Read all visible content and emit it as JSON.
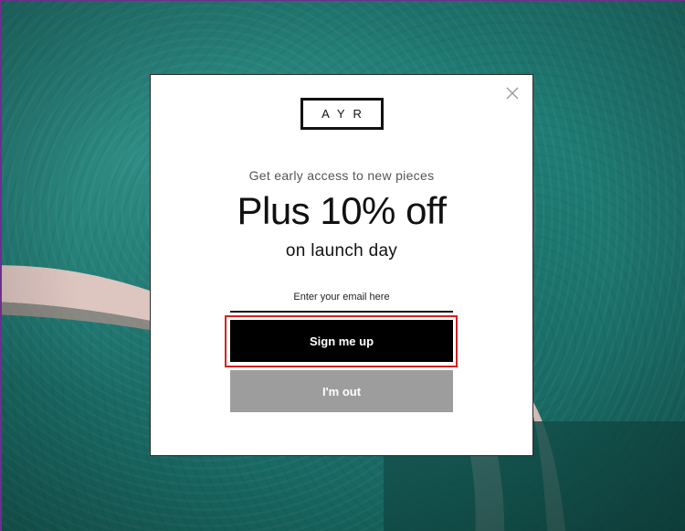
{
  "popup": {
    "logo_text": "AYR",
    "subhead": "Get early access to new pieces",
    "headline": "Plus 10% off",
    "subline": "on launch day",
    "email_placeholder": "Enter your email here",
    "email_value": "",
    "signup_label": "Sign me up",
    "optout_label": "I'm out",
    "close_icon": "close-icon"
  },
  "colors": {
    "backdrop": "#1d7670",
    "popup_bg": "#ffffff",
    "signup_bg": "#000000",
    "optout_bg": "#9d9d9d",
    "highlight": "#d6201f"
  }
}
